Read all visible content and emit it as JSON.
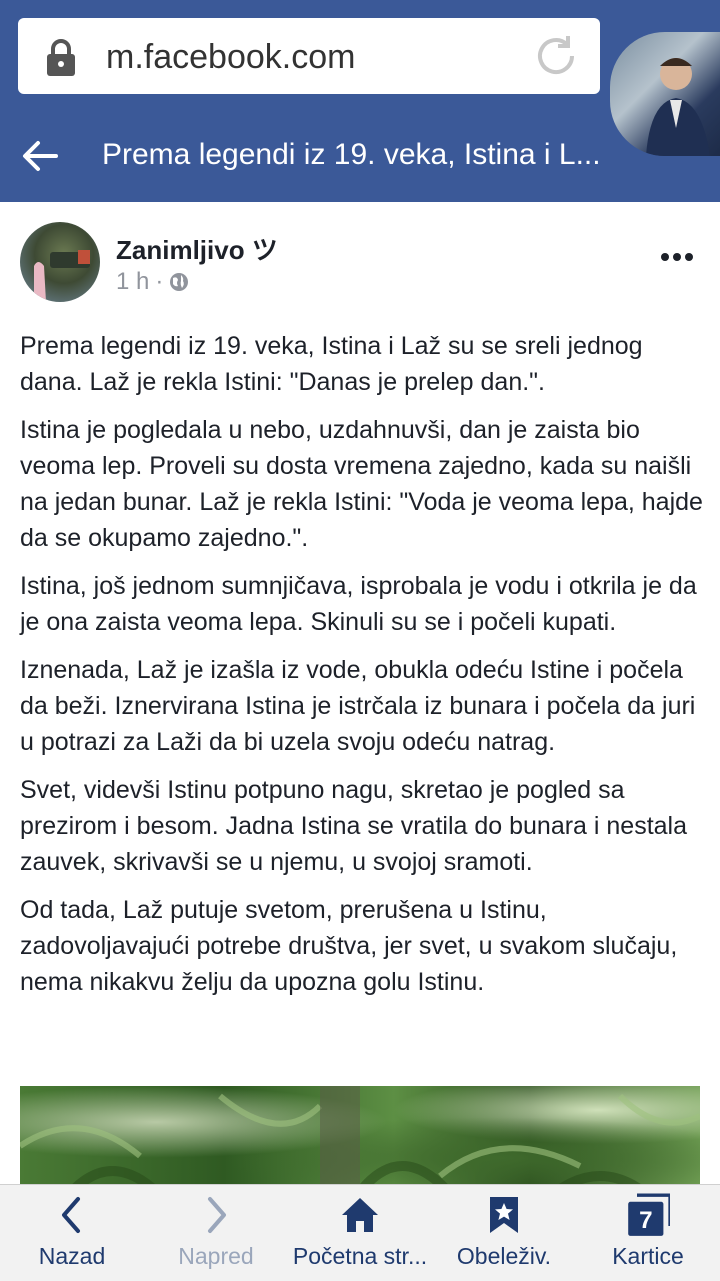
{
  "browser": {
    "url": "m.facebook.com",
    "page_title": "Prema legendi iz 19. veka, Istina i L..."
  },
  "post": {
    "author": "Zanimljivo ツ",
    "time": "1 h",
    "separator": "·",
    "paragraphs": [
      "Prema legendi iz 19. veka, Istina i Laž su se sreli jednog dana. Laž je rekla Istini: \"Danas je prelep dan.\".",
      "Istina je pogledala u nebo, uzdahnuvši, dan je zaista bio veoma lep. Proveli su dosta vremena zajedno, kada su naišli na jedan bunar. Laž je rekla Istini: \"Voda je veoma lepa, hajde da se okupamo zajedno.\".",
      "Istina, još jednom sumnjičava, isprobala je vodu i otkrila je da je ona zaista veoma lepa. Skinuli su se i počeli kupati.",
      "Iznenada, Laž je izašla iz vode, obukla odeću Istine i počela da beži. Iznervirana Istina je istrčala iz bunara i počela da juri u potrazi za Laži da bi uzela svoju odeću natrag.",
      "Svet, videvši Istinu potpuno nagu, skretao je pogled sa prezirom i besom. Jadna Istina se vratila do bunara i nestala zauvek, skrivavši se u njemu, u svojoj sramoti.",
      "Od tada, Laž putuje svetom, prerušena u Istinu, zadovoljavajući potrebe društva, jer svet, u svakom slučaju, nema nikakvu želju da upozna golu Istinu."
    ]
  },
  "bottom_nav": {
    "back": "Nazad",
    "forward": "Napred",
    "home": "Početna str...",
    "bookmarks": "Obeleživ.",
    "tabs": "Kartice",
    "tab_count": "7"
  },
  "colors": {
    "facebook_blue": "#3b5998",
    "nav_icon": "#1f3a6e"
  }
}
